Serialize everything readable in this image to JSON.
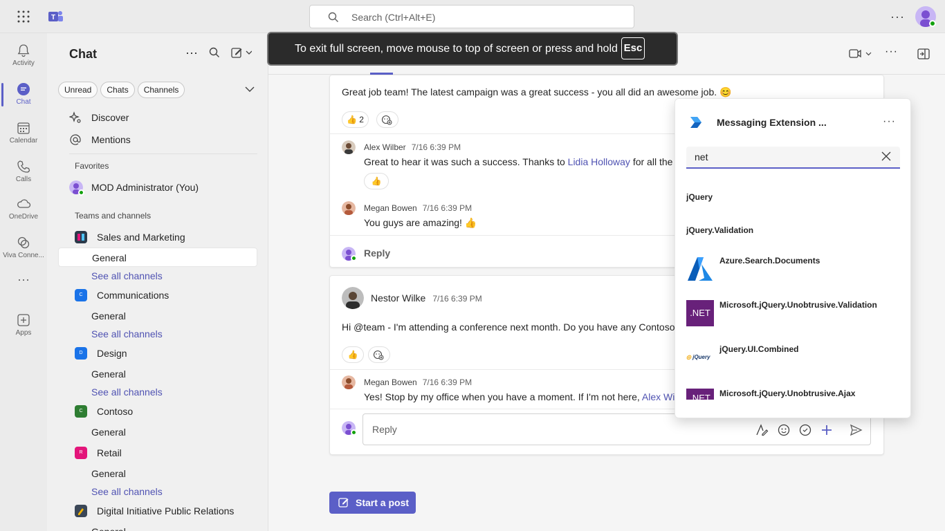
{
  "topbar": {
    "search_placeholder": "Search (Ctrl+Alt+E)",
    "more": "···"
  },
  "rail": {
    "items": [
      {
        "label": "Activity",
        "icon": "bell-icon"
      },
      {
        "label": "Chat",
        "icon": "chat-icon",
        "active": true
      },
      {
        "label": "Calendar",
        "icon": "calendar-icon"
      },
      {
        "label": "Calls",
        "icon": "phone-icon"
      },
      {
        "label": "OneDrive",
        "icon": "cloud-icon"
      },
      {
        "label": "Viva Conne...",
        "icon": "viva-icon"
      },
      {
        "label": "···",
        "icon": "more-icon"
      },
      {
        "label": "Apps",
        "icon": "add-apps-icon"
      }
    ]
  },
  "leftpane": {
    "title": "Chat",
    "filters": [
      "Unread",
      "Chats",
      "Channels"
    ],
    "nav": [
      {
        "label": "Discover",
        "icon": "sparkle-icon"
      },
      {
        "label": "Mentions",
        "icon": "at-icon"
      }
    ],
    "favorites_header": "Favorites",
    "favorite": "MOD Administrator (You)",
    "teams_header": "Teams and channels",
    "teams": [
      {
        "name": "Sales and Marketing",
        "badge": "",
        "color": "#2b3a4a",
        "channels": [
          "General"
        ],
        "see_all": "See all channels"
      },
      {
        "name": "Communications",
        "badge": "C",
        "color": "#1a73e8",
        "channels": [
          "General"
        ],
        "see_all": "See all channels"
      },
      {
        "name": "Design",
        "badge": "D",
        "color": "#1a73e8",
        "channels": [
          "General"
        ],
        "see_all": "See all channels"
      },
      {
        "name": "Contoso",
        "badge": "C",
        "color": "#2e7d32",
        "channels": [
          "General"
        ]
      },
      {
        "name": "Retail",
        "badge": "R",
        "color": "#e3157a",
        "channels": [
          "General"
        ],
        "see_all": "See all channels"
      },
      {
        "name": "Digital Initiative Public Relations",
        "badge": "",
        "color": "#3b4757",
        "channels": [
          "General"
        ]
      }
    ]
  },
  "banner": {
    "text": "To exit full screen, move mouse to top of screen or press and hold",
    "key": "Esc"
  },
  "thread1": {
    "text": "Great job team! The latest campaign was a great success - you all did an awesome job. 😊",
    "reaction_count": "2",
    "replies": [
      {
        "author": "Alex Wilber",
        "time": "7/16 6:39 PM",
        "text_before": "Great to hear it was such a success. Thanks to ",
        "mention": "Lidia Holloway",
        "text_after": " for all the g"
      },
      {
        "author": "Megan Bowen",
        "time": "7/16 6:39 PM",
        "text": "You guys are amazing! 👍"
      }
    ],
    "reply_label": "Reply"
  },
  "thread2": {
    "author": "Nestor Wilke",
    "time": "7/16 6:39 PM",
    "text": "Hi @team - I'm attending a conference next month. Do you have any Contoso",
    "reply": {
      "author": "Megan Bowen",
      "time": "7/16 6:39 PM",
      "text_before": "Yes! Stop by my office when you have a moment. If I'm not here, ",
      "mention": "Alex Wil"
    },
    "reply_placeholder": "Reply"
  },
  "start_post": "Start a post",
  "extension": {
    "title": "Messaging Extension ...",
    "query": "net",
    "results": [
      {
        "name": "jQuery"
      },
      {
        "name": "jQuery.Validation"
      },
      {
        "name": "Azure.Search.Documents",
        "thumb": "azure-logo-icon"
      },
      {
        "name": "Microsoft.jQuery.Unobtrusive.Validation",
        "thumb_text": ".NET"
      },
      {
        "name": "jQuery.UI.Combined",
        "thumb_text": "jQuery"
      },
      {
        "name": "Microsoft.jQuery.Unobtrusive.Ajax",
        "thumb_text": ".NET"
      }
    ]
  },
  "colors": {
    "accent": "#5b5fc7",
    "net_purple": "#68217a",
    "presence": "#13a10e"
  }
}
